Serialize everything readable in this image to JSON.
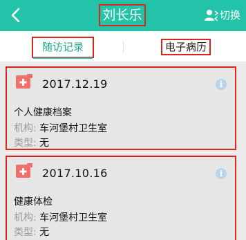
{
  "header": {
    "title": "刘长乐",
    "switch_label": "切换",
    "background": "#22c3a9"
  },
  "tabs": [
    {
      "label": "随访记录",
      "active": true
    },
    {
      "label": "电子病历",
      "active": false
    }
  ],
  "records": [
    {
      "date": "2017.12.19",
      "type": "个人健康档案",
      "org_key": "机构:",
      "org_value": "车河堡村卫生室",
      "kind_key": "类型:",
      "kind_value": "无"
    },
    {
      "date": "2017.10.16",
      "type": "健康体检",
      "org_key": "机构:",
      "org_value": "车河堡村卫生室",
      "kind_key": "类型:",
      "kind_value": "无"
    }
  ],
  "icons": {
    "back": "back-arrow-icon",
    "switch": "user-switch-icon",
    "record": "medical-record-icon",
    "info": "info-icon"
  },
  "colors": {
    "accent": "#22c3a9",
    "highlight_border": "#d8261f",
    "record_icon": "#ef6f6a",
    "info_icon": "#b9d4ea"
  }
}
